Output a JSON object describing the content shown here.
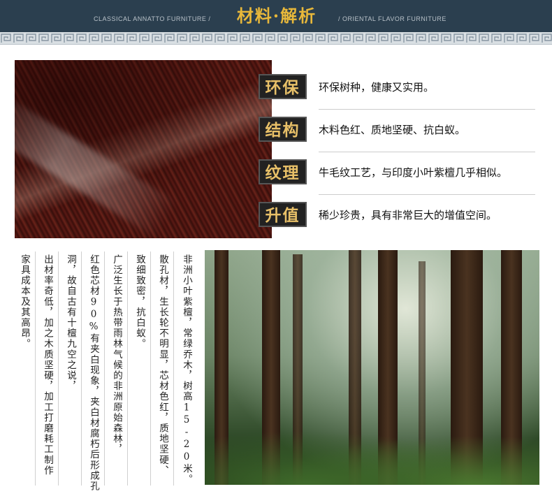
{
  "header": {
    "title": "材料·解析",
    "subtitle_left": "CLASSICAL ANNATTO FURNITURE /",
    "subtitle_right": "/ ORIENTAL FLAVOR FURNITURE"
  },
  "features": [
    {
      "tag": "环保",
      "desc": "环保树种，健康又实用。"
    },
    {
      "tag": "结构",
      "desc": "木料色红、质地坚硬、抗白蚁。"
    },
    {
      "tag": "纹理",
      "desc": "牛毛纹工艺，与印度小叶紫檀几乎相似。"
    },
    {
      "tag": "升值",
      "desc": "稀少珍贵，具有非常巨大的增值空间。"
    }
  ],
  "columns": [
    "非洲小叶紫檀，常绿乔木，树高15-20米。",
    "散孔材，生长轮不明显，芯材色红，质地坚硬、",
    "致细致密，抗白蚁。",
    "广泛生长于热带雨林气候的非洲原始森林，",
    "红色芯材90%有夹白现象，夹白材腐朽后形成孔",
    "洞，故自古有十檀九空之说，",
    "出材率奇低，加之木质坚硬，加工打磨耗工制作",
    "家具成本及其高昂。"
  ],
  "colors": {
    "header_bg": "#2b3f4f",
    "title_gold": "#e8b83a",
    "tag_bg": "#222222",
    "tag_text": "#e8c068"
  }
}
